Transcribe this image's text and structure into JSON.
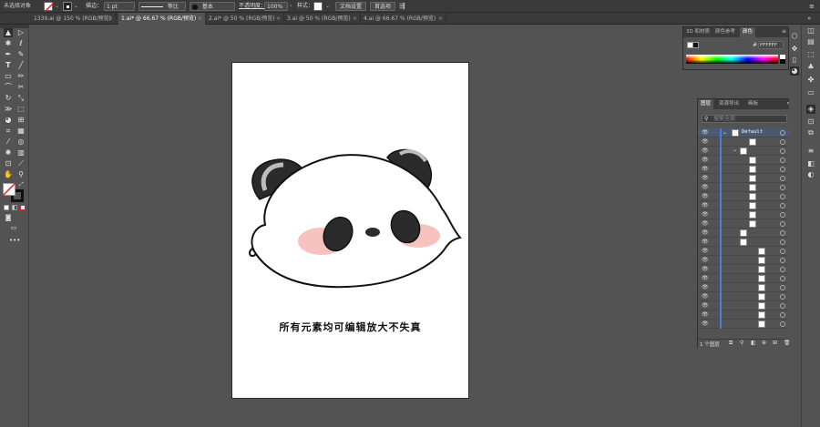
{
  "control_bar": {
    "selection_status": "未选择对象",
    "stroke_label": "描边：",
    "stroke_weight": "1 pt",
    "stroke_profile": "等比",
    "brush_label": "基本",
    "opacity_label": "不透明度：",
    "opacity_value": "100%",
    "style_label": "样式：",
    "doc_setup_button": "文档设置",
    "preferences_button": "首选项"
  },
  "tabs": [
    {
      "label": "1339.ai @ 150 % (RGB/预览)",
      "active": false
    },
    {
      "label": "1.ai* @ 66.67 % (RGB/预览)",
      "active": true
    },
    {
      "label": "2.ai* @ 50 % (RGB/预览)",
      "active": false
    },
    {
      "label": "3.ai @ 50 % (RGB/预览)",
      "active": false
    },
    {
      "label": "4.ai @ 66.67 % (RGB/预览)",
      "active": false
    }
  ],
  "artboard": {
    "caption": "所有元素均可编辑放大不失真"
  },
  "color_panel": {
    "tabs": [
      "3D 和材质",
      "颜色参考",
      "颜色"
    ],
    "active_tab": "颜色",
    "hex_value": "FFFFFF"
  },
  "layers_panel": {
    "tabs": [
      "图层",
      "资源导出",
      "画板"
    ],
    "active_tab": "图层",
    "search_placeholder": "搜索全部",
    "top_layer_name": "Default",
    "status": "1 个图层",
    "row_count": 22
  },
  "colors": {
    "panda_black": "#2b2b2b",
    "panda_gray": "#bdbdbd",
    "blush": "#f7c1bd",
    "selection_blue": "#4b7cd8"
  }
}
